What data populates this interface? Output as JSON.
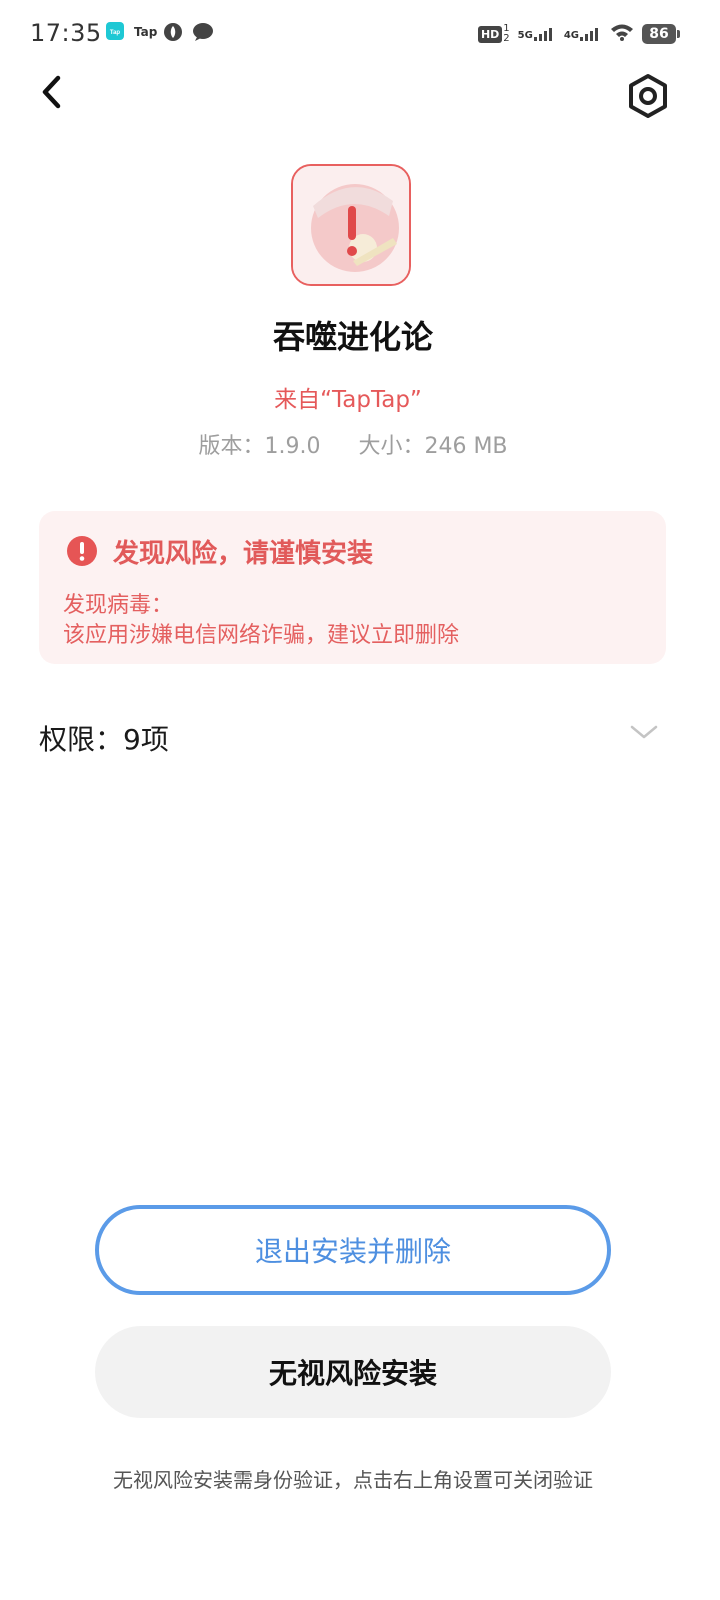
{
  "status_bar": {
    "time": "17:35",
    "notification_icons": [
      "taptap-app-icon",
      "tap-icon",
      "bug-icon",
      "chat-bubble-icon"
    ],
    "tap_label": "Tap",
    "hd_label": "HD",
    "signal_5g_label": "5G",
    "signal_4g_label": "4G",
    "battery": "86"
  },
  "nav": {
    "back_icon": "back-arrow-icon",
    "settings_icon": "settings-icon"
  },
  "app": {
    "name": "吞噬进化论",
    "source": "来自“TapTap”",
    "version_text": "版本：1.9.0",
    "size_text": "大小：246 MB",
    "icon": "app-icon-with-warning"
  },
  "risk": {
    "title": "发现风险，请谨慎安装",
    "line1": "发现病毒：",
    "line2": "该应用涉嫌电信网络诈骗，建议立即删除",
    "color": "#e55a5a"
  },
  "permissions": {
    "label": "权限：9项"
  },
  "buttons": {
    "exit_label": "退出安装并删除",
    "ignore_label": "无视风险安装"
  },
  "footnote": "无视风险安装需身份验证，点击右上角设置可关闭验证",
  "colors": {
    "accent_blue": "#5b9be8",
    "danger_red": "#e65555"
  }
}
